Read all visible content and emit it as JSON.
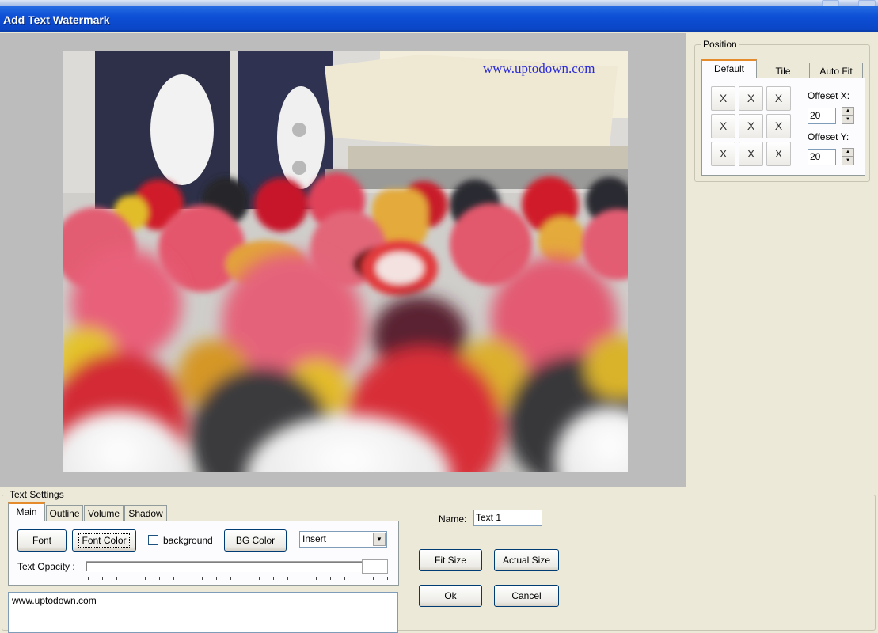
{
  "window": {
    "title": "Add Text Watermark"
  },
  "preview": {
    "watermark_text": "www.uptodown.com"
  },
  "position": {
    "group_label": "Position",
    "tabs": [
      {
        "label": "Default",
        "active": true
      },
      {
        "label": "Tile",
        "active": false
      },
      {
        "label": "Auto Fit",
        "active": false
      }
    ],
    "grid_buttons": [
      "X",
      "X",
      "X",
      "X",
      "X",
      "X",
      "X",
      "X",
      "X"
    ],
    "offset_x_label": "Offeset X:",
    "offset_x_value": "20",
    "offset_y_label": "Offeset Y:",
    "offset_y_value": "20"
  },
  "text_settings": {
    "group_label": "Text Settings",
    "tabs": [
      {
        "label": "Main",
        "active": true
      },
      {
        "label": "Outline",
        "active": false
      },
      {
        "label": "Volume",
        "active": false
      },
      {
        "label": "Shadow",
        "active": false
      }
    ],
    "font_button": "Font",
    "font_color_button": "Font Color",
    "background_checkbox_label": "background",
    "background_checked": false,
    "bg_color_button": "BG Color",
    "mode_select_value": "Insert",
    "opacity_label": "Text Opacity :",
    "opacity_value": 1.0,
    "text_value": "www.uptodown.com",
    "name_label": "Name:",
    "name_value": "Text 1",
    "fit_size_button": "Fit Size",
    "actual_size_button": "Actual Size",
    "ok_button": "Ok",
    "cancel_button": "Cancel"
  },
  "colors": {
    "titlebar": "#0a45c4",
    "dialog_bg": "#ece9d8",
    "preview_bg": "#bcbcbc",
    "watermark": "#2a2ad8",
    "active_tab_accent": "#e68b2c"
  },
  "icons": {
    "grid_button_glyph": "x-mark-icon",
    "spin_up": "arrow-up-icon",
    "spin_down": "arrow-down-icon",
    "dropdown": "chevron-down-icon"
  }
}
